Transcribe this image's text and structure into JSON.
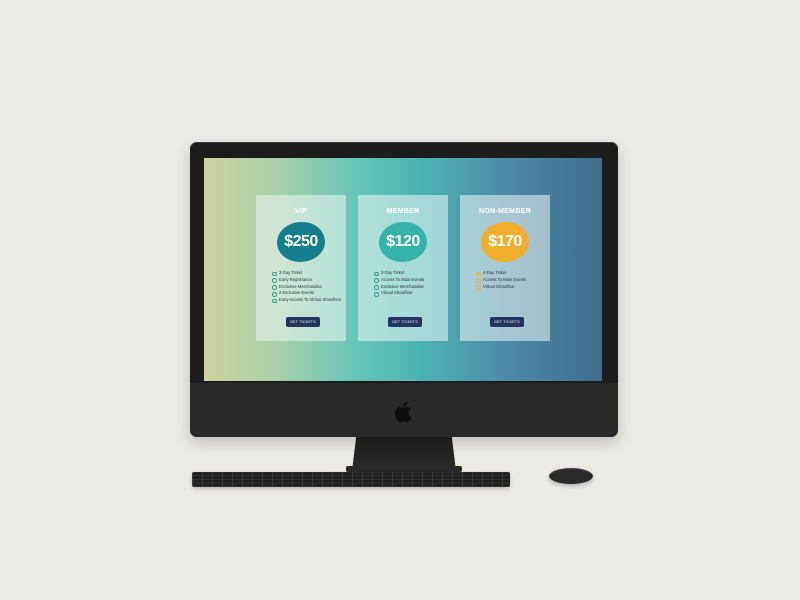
{
  "pricing": {
    "plans": [
      {
        "name": "VIP",
        "price": "$250",
        "blob_color": "#157e8c",
        "features": [
          "3-Day Ticket",
          "Early Registration",
          "Exclusive Merchandise",
          "2 Exclusive Events",
          "Early Access To Virtual Showfloor"
        ],
        "button": "GET TICKETS"
      },
      {
        "name": "MEMBER",
        "price": "$120",
        "blob_color": "#34b3a8",
        "features": [
          "3-Day Ticket",
          "Access To Main Events",
          "Exclusive Merchandise",
          "Virtual Showfloor"
        ],
        "button": "GET TICKETS"
      },
      {
        "name": "NON-MEMBER",
        "price": "$170",
        "blob_color": "#f2ad2c",
        "features": [
          "4-Day Ticket",
          "Access To Main Events",
          "Virtual Showfloor"
        ],
        "button": "GET TICKETS"
      }
    ]
  },
  "colors": {
    "button_bg": "#23355e",
    "bullet": "#2a9e8e"
  },
  "icons": {
    "logo": "apple-logo-icon",
    "bullet": "circle-bullet-icon"
  }
}
